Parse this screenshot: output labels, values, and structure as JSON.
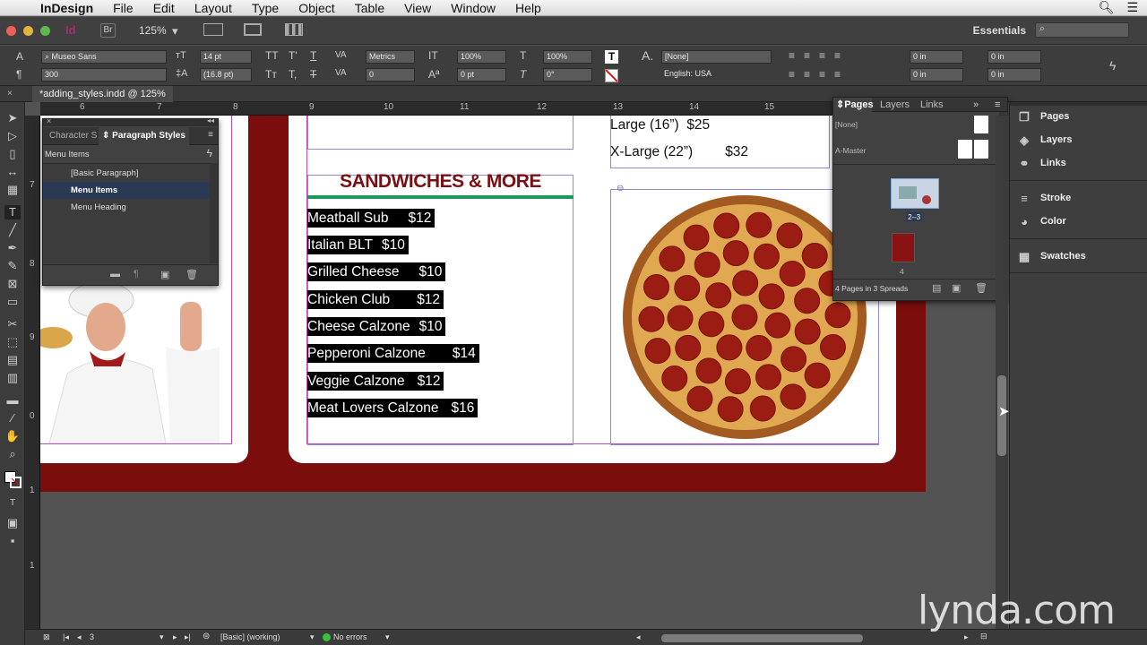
{
  "menubar": {
    "app_name": "InDesign",
    "items": [
      "File",
      "Edit",
      "Layout",
      "Type",
      "Object",
      "Table",
      "View",
      "Window",
      "Help"
    ]
  },
  "appbar": {
    "br_label": "Br",
    "zoom": "125%",
    "workspace": "Essentials",
    "search_placeholder": ""
  },
  "control": {
    "font_family": "Museo Sans",
    "font_style": "300",
    "font_size": "14 pt",
    "leading": "(16.8 pt)",
    "kerning": "Metrics",
    "tracking": "0",
    "vscale": "100%",
    "hscale": "100%",
    "baseline": "0 pt",
    "skew": "0°",
    "char_style": "[None]",
    "language": "English: USA",
    "indent_left": "0 in",
    "indent_right": "0 in",
    "space_before": "0 in",
    "space_after": "0 in"
  },
  "document": {
    "tab_title": "*adding_styles.indd @ 125%"
  },
  "ruler": {
    "h_labels": [
      "6",
      "7",
      "8",
      "9",
      "10",
      "11",
      "12",
      "13",
      "14",
      "15"
    ],
    "v_labels": [
      "7",
      "8",
      "9",
      "0",
      "1",
      "1"
    ]
  },
  "menu": {
    "heading": "SANDWICHES & MORE",
    "items": [
      {
        "name": "Meatball Sub",
        "price": "$12"
      },
      {
        "name": "Italian BLT",
        "price": "$10"
      },
      {
        "name": "Grilled Cheese",
        "price": "$10"
      },
      {
        "name": "Chicken Club",
        "price": "$12"
      },
      {
        "name": "Cheese Calzone",
        "price": "$10"
      },
      {
        "name": "Pepperoni Calzone",
        "price": "$14"
      },
      {
        "name": "Veggie Calzone",
        "price": "$12"
      },
      {
        "name": "Meat Lovers Calzone",
        "price": "$16"
      }
    ],
    "pizza_sizes": [
      {
        "name": "Large (16”)",
        "price": "$25"
      },
      {
        "name": "X-Large (22”)",
        "price": "$32"
      }
    ]
  },
  "para_styles_panel": {
    "tab_character": "Character S",
    "tab_paragraph": "Paragraph Styles",
    "current_style": "Menu Items",
    "styles": [
      "[Basic Paragraph]",
      "Menu Items",
      "Menu Heading"
    ],
    "selected_index": 1
  },
  "pages_panel": {
    "tabs": [
      "Pages",
      "Layers",
      "Links"
    ],
    "masters": [
      "[None]",
      "A-Master"
    ],
    "spread_label_1": "2–3",
    "spread_label_2": "4",
    "footer": "4 Pages in 3 Spreads"
  },
  "dock": {
    "items": [
      "Pages",
      "Layers",
      "Links",
      "Stroke",
      "Color",
      "Swatches"
    ]
  },
  "status": {
    "page": "3",
    "style": "[Basic] (working)",
    "preflight": "No errors"
  },
  "watermark": "lynda.com",
  "colors": {
    "menu_heading": "#7a0f14",
    "heading_rule": "#1a9b5c",
    "page_border": "#7b0d0d"
  }
}
